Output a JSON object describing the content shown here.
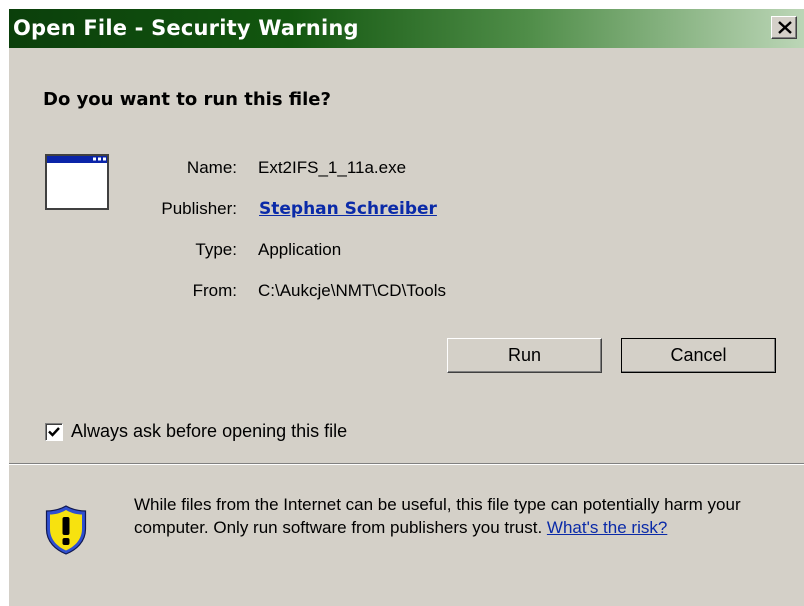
{
  "window": {
    "title": "Open File - Security Warning"
  },
  "dialog": {
    "question": "Do you want to run this file?",
    "fields": {
      "name_label": "Name:",
      "name_value": "Ext2IFS_1_11a.exe",
      "publisher_label": "Publisher:",
      "publisher_value": "Stephan Schreiber",
      "type_label": "Type:",
      "type_value": "Application",
      "from_label": "From:",
      "from_value": "C:\\Aukcje\\NMT\\CD\\Tools"
    },
    "buttons": {
      "run": "Run",
      "cancel": "Cancel"
    },
    "checkbox": {
      "label": "Always ask before opening this file",
      "checked": true
    },
    "warning": {
      "text": "While files from the Internet can be useful, this file type can potentially harm your computer. Only run software from publishers you trust.",
      "link": "What's the risk?"
    }
  },
  "icons": {
    "close": "close-icon",
    "application": "application-window-icon",
    "checkmark": "checkmark-icon",
    "warning": "warning-shield-icon"
  },
  "colors": {
    "titlebar_start": "#0b3f0b",
    "titlebar_end": "#bcd6b7",
    "dialog_bg": "#d4d0c8",
    "link": "#0a2aa8",
    "shield_yellow": "#f7e20f",
    "shield_blue": "#2f4fd0"
  }
}
